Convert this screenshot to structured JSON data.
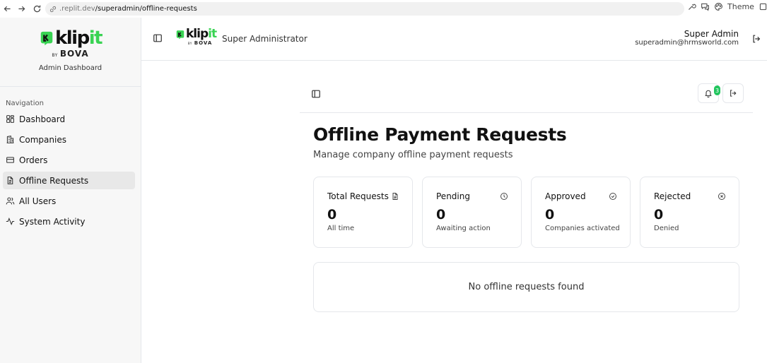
{
  "browser": {
    "url_host": ".replit.dev",
    "url_path": "/superadmin/offline-requests",
    "theme_label": "Theme"
  },
  "brand": {
    "logo_text_main": "klip",
    "logo_text_accent": "it",
    "by": "BY",
    "bova": "BOVA",
    "subtitle": "Admin Dashboard",
    "accent_color": "#39d353"
  },
  "sidebar": {
    "caption": "Navigation",
    "items": [
      {
        "label": "Dashboard",
        "icon": "grid-icon"
      },
      {
        "label": "Companies",
        "icon": "building-icon"
      },
      {
        "label": "Orders",
        "icon": "credit-card-icon"
      },
      {
        "label": "Offline Requests",
        "icon": "document-icon",
        "active": true
      },
      {
        "label": "All Users",
        "icon": "users-icon"
      },
      {
        "label": "System Activity",
        "icon": "activity-icon"
      }
    ]
  },
  "header": {
    "role": "Super Administrator",
    "user_name": "Super Admin",
    "user_email": "superadmin@hrmsworld.com"
  },
  "toolbar": {
    "notification_count": "3"
  },
  "main": {
    "title": "Offline Payment Requests",
    "subtitle": "Manage company offline payment requests",
    "stats": [
      {
        "label": "Total Requests",
        "value": "0",
        "note": "All time",
        "icon": "document-icon"
      },
      {
        "label": "Pending",
        "value": "0",
        "note": "Awaiting action",
        "icon": "clock-icon"
      },
      {
        "label": "Approved",
        "value": "0",
        "note": "Companies activated",
        "icon": "check-circle-icon"
      },
      {
        "label": "Rejected",
        "value": "0",
        "note": "Denied",
        "icon": "x-circle-icon"
      }
    ],
    "empty_message": "No offline requests found"
  }
}
